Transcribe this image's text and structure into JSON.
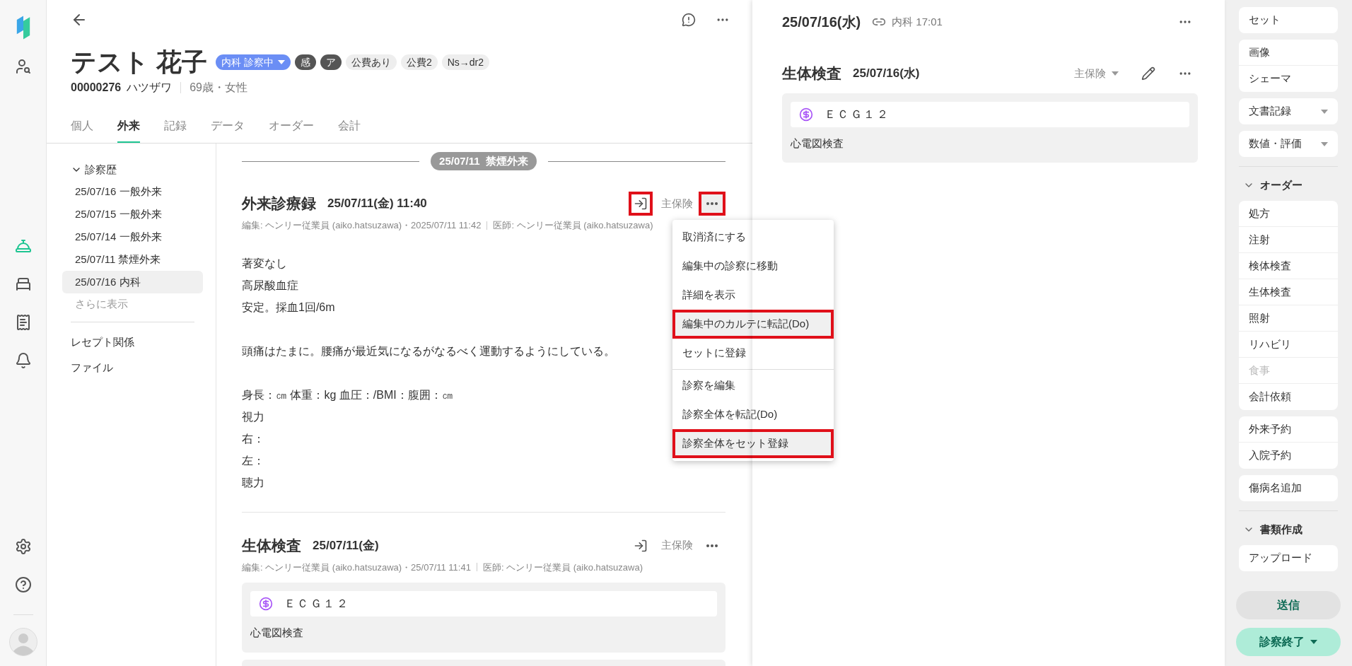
{
  "nav_rail": [
    {
      "kind": "logo"
    },
    {
      "kind": "patient-search",
      "selected": false
    },
    {
      "kind": "reception",
      "selected": true
    },
    {
      "kind": "bed",
      "selected": false
    },
    {
      "kind": "receipt",
      "selected": false
    },
    {
      "kind": "bell",
      "selected": false
    },
    {
      "kind": "settings",
      "selected": false
    },
    {
      "kind": "help",
      "selected": false
    },
    {
      "kind": "avatar"
    }
  ],
  "patient": {
    "name": "テスト 花子",
    "badges": [
      {
        "text": "内科 診察中",
        "kind": "status"
      },
      {
        "text": "感",
        "kind": "dark"
      },
      {
        "text": "ア",
        "kind": "dark"
      },
      {
        "text": "公費あり",
        "kind": "light"
      },
      {
        "text": "公費2",
        "kind": "light"
      },
      {
        "text": "Ns→dr2",
        "kind": "light"
      }
    ],
    "id": "00000276",
    "kana": "ハツザワ",
    "age_sex": "69歳・女性"
  },
  "tabs": [
    {
      "label": "個人",
      "selected": false
    },
    {
      "label": "外来",
      "selected": true
    },
    {
      "label": "記録",
      "selected": false
    },
    {
      "label": "データ",
      "selected": false
    },
    {
      "label": "オーダー",
      "selected": false
    },
    {
      "label": "会計",
      "selected": false
    }
  ],
  "history": {
    "heading": "診察歴",
    "expanded": true,
    "items": [
      {
        "label": "25/07/16 一般外来",
        "selected": false
      },
      {
        "label": "25/07/15 一般外来",
        "selected": false
      },
      {
        "label": "25/07/14 一般外来",
        "selected": false
      },
      {
        "label": "25/07/11 禁煙外来",
        "selected": false
      },
      {
        "label": "25/07/16 内科",
        "selected": true
      }
    ],
    "more": "さらに表示",
    "links": [
      "レセプト関係",
      "ファイル"
    ]
  },
  "timeline": {
    "date_divider": "25/07/11  禁煙外来",
    "records": [
      {
        "kind": "note",
        "title": "外来診療録",
        "date": "25/07/11(金) 11:40",
        "edited": "編集: ヘンリー従業員 (aiko.hatsuzawa)・2025/07/11 11:42",
        "doctor": "医師: ヘンリー従業員 (aiko.hatsuzawa)",
        "insurance": "主保険",
        "transfer_highlighted": true,
        "more_highlighted": true,
        "paragraphs": [
          [
            "著変なし",
            "高尿酸血症",
            "安定。採血1回/6m"
          ],
          [
            "頭痛はたまに。腰痛が最近気になるがなるべく運動するようにしている。"
          ],
          [
            "身長：㎝ 体重：kg 血圧：/BMI：腹囲：㎝",
            "視力",
            "右：",
            "左：",
            "聴力"
          ]
        ]
      },
      {
        "kind": "exam",
        "title": "生体検査",
        "date": "25/07/11(金)",
        "edited": "編集: ヘンリー従業員 (aiko.hatsuzawa)・25/07/11 11:41",
        "doctor": "医師: ヘンリー従業員 (aiko.hatsuzawa)",
        "insurance": "主保険",
        "transfer_highlighted": false,
        "more_highlighted": false,
        "item": "ＥＣＧ１２",
        "description": "心電図検査"
      }
    ]
  },
  "menu": {
    "groups": [
      [
        {
          "label": "取消済にする",
          "highlighted": false
        },
        {
          "label": "編集中の診察に移動",
          "highlighted": false
        },
        {
          "label": "詳細を表示",
          "highlighted": false
        },
        {
          "label": "編集中のカルテに転記(Do)",
          "highlighted": true
        },
        {
          "label": "セットに登録",
          "highlighted": false
        }
      ],
      [
        {
          "label": "診察を編集",
          "highlighted": false
        },
        {
          "label": "診察全体を転記(Do)",
          "highlighted": false
        },
        {
          "label": "診察全体をセット登録",
          "highlighted": true
        }
      ]
    ]
  },
  "current": {
    "date": "25/07/16(水)",
    "link": "内科 17:01",
    "record": {
      "title": "生体検査",
      "date": "25/07/16(水)",
      "insurance": "主保険",
      "item": "ＥＣＧ１２",
      "description": "心電図検査"
    }
  },
  "tools": {
    "top_groups": [
      [
        {
          "label": "セット",
          "dropdown": false,
          "disabled": false
        }
      ],
      [
        {
          "label": "画像",
          "dropdown": false,
          "disabled": false
        },
        {
          "label": "シェーマ",
          "dropdown": false,
          "disabled": false
        }
      ],
      [
        {
          "label": "文書記録",
          "dropdown": true,
          "disabled": false
        }
      ],
      [
        {
          "label": "数値・評価",
          "dropdown": true,
          "disabled": false
        }
      ]
    ],
    "sections": [
      {
        "heading": "オーダー",
        "expanded": true,
        "groups": [
          [
            {
              "label": "処方",
              "dropdown": false,
              "disabled": false
            },
            {
              "label": "注射",
              "dropdown": false,
              "disabled": false
            },
            {
              "label": "検体検査",
              "dropdown": false,
              "disabled": false
            },
            {
              "label": "生体検査",
              "dropdown": false,
              "disabled": false
            },
            {
              "label": "照射",
              "dropdown": false,
              "disabled": false
            },
            {
              "label": "リハビリ",
              "dropdown": false,
              "disabled": false
            },
            {
              "label": "食事",
              "dropdown": false,
              "disabled": true
            },
            {
              "label": "会計依頼",
              "dropdown": false,
              "disabled": false
            }
          ],
          [
            {
              "label": "外来予約",
              "dropdown": false,
              "disabled": false
            },
            {
              "label": "入院予約",
              "dropdown": false,
              "disabled": false
            }
          ],
          [
            {
              "label": "傷病名追加",
              "dropdown": false,
              "disabled": false
            }
          ]
        ]
      },
      {
        "heading": "書類作成",
        "expanded": true,
        "groups": [
          [
            {
              "label": "アップロード",
              "dropdown": false,
              "disabled": false
            }
          ]
        ]
      }
    ],
    "send": "送信",
    "finish": "診察終了"
  }
}
